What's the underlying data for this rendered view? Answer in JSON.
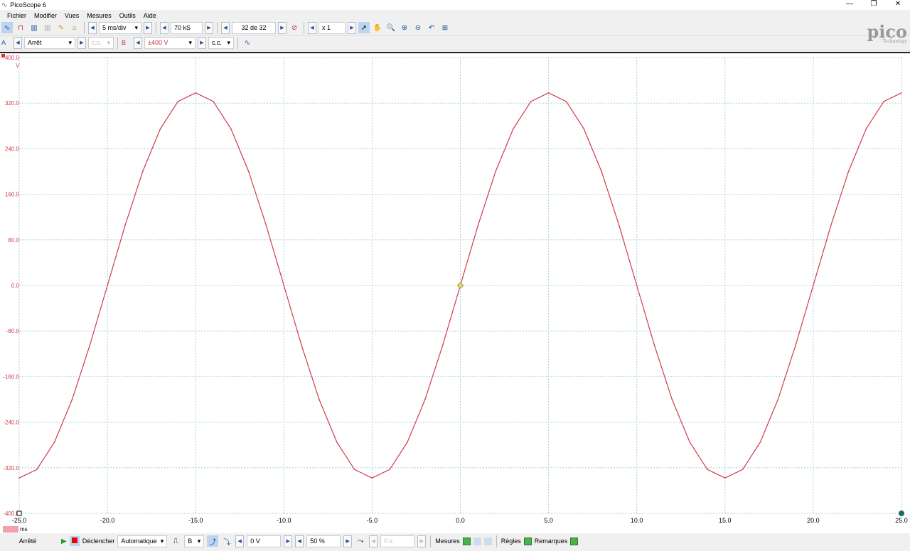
{
  "window": {
    "title": "PicoScope 6",
    "controls": [
      "—",
      "❐",
      "✕"
    ]
  },
  "menu": [
    "Fichier",
    "Modifier",
    "Vues",
    "Mesures",
    "Outils",
    "Aide"
  ],
  "toolbar": {
    "timebase": "5 ms/div",
    "samples": "70 kS",
    "buffer": "32 de 32",
    "zoom": "x 1"
  },
  "channels": {
    "a_label": "A",
    "a_range": "Arrêt",
    "a_coupling": "c.c.",
    "b_label": "B",
    "b_range": "±400 V",
    "b_coupling": "c.c."
  },
  "logo": {
    "name": "pico",
    "sub": "Technology"
  },
  "bottom": {
    "status": "Arrêté",
    "trigger_label": "Déclencher",
    "trigger_mode": "Automatique",
    "trigger_channel": "B",
    "threshold": "0 V",
    "pretrigger": "50 %",
    "delay": "0 s",
    "measures": "Mesures",
    "rules": "Règles",
    "notes": "Remarques"
  },
  "colors": {
    "trace": "#d03a4a",
    "grid": "#a8cfd8",
    "accent": "#1a4f9c"
  },
  "chart_data": {
    "type": "line",
    "x_unit": "ms",
    "y_unit": "V",
    "xlim": [
      -25,
      25
    ],
    "ylim": [
      -400,
      400
    ],
    "x_ticks": [
      "-25.0",
      "-20.0",
      "-15.0",
      "-10.0",
      "-5.0",
      "0.0",
      "5.0",
      "10.0",
      "15.0",
      "20.0",
      "25.0"
    ],
    "y_ticks": [
      "400.0",
      "320.0",
      "240.0",
      "160.0",
      "80.0",
      "0.0",
      "-80.0",
      "-160.0",
      "-240.0",
      "-320.0",
      "-400.0"
    ],
    "grid": true,
    "series": [
      {
        "channel": "B",
        "x_start": -25,
        "x_step": 1,
        "values": [
          -338,
          -323,
          -275,
          -200,
          -105,
          0,
          105,
          200,
          275,
          323,
          338,
          323,
          275,
          200,
          105,
          0,
          -105,
          -200,
          -275,
          -323,
          -338,
          -323,
          -275,
          -200,
          -105,
          0,
          105,
          200,
          275,
          323,
          338,
          323,
          275,
          200,
          105,
          0,
          -105,
          -200,
          -275,
          -323,
          -338,
          -323,
          -275,
          -200,
          -105,
          0,
          105,
          200,
          275,
          323,
          338
        ]
      }
    ],
    "trigger_marker": {
      "x": 0,
      "y": 0
    }
  }
}
